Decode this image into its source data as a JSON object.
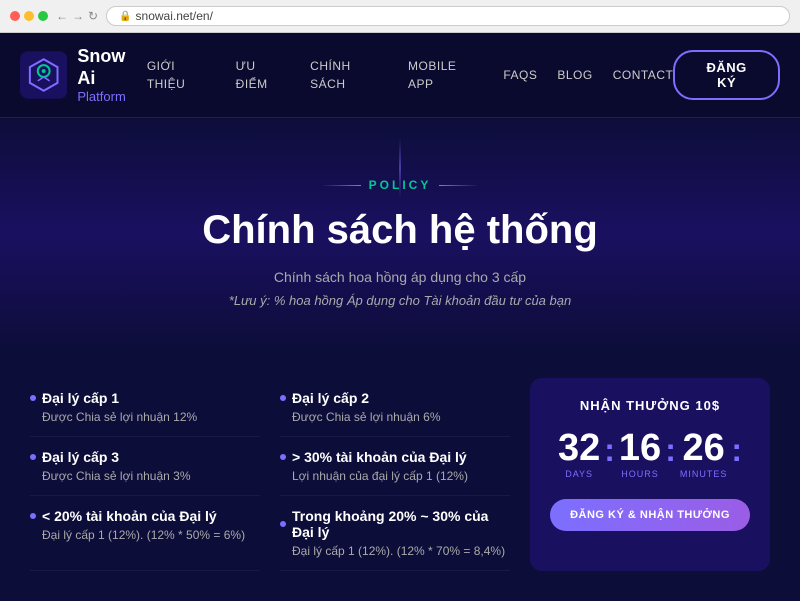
{
  "browser": {
    "url": "snowai.net/en/",
    "lock_text": "🔒"
  },
  "navbar": {
    "logo_name": "Snow Ai",
    "logo_sub": "Platform",
    "nav_items": [
      {
        "label": "GIỚI THIỆU",
        "href": "#"
      },
      {
        "label": "ƯU ĐIỂM",
        "href": "#"
      },
      {
        "label": "CHÍNH SÁCH",
        "href": "#"
      },
      {
        "label": "MOBILE APP",
        "href": "#"
      },
      {
        "label": "FAQS",
        "href": "#"
      },
      {
        "label": "BLOG",
        "href": "#"
      },
      {
        "label": "CONTACT",
        "href": "#"
      }
    ],
    "register_btn": "ĐĂNG KÝ"
  },
  "hero": {
    "policy_label": "POLICY",
    "title": "Chính sách hệ thống",
    "subtitle": "Chính sách hoa hồng áp dụng cho 3 cấp",
    "note": "*Lưu ý: % hoa hồng Áp dụng cho Tài khoản đầu tư của bạn"
  },
  "policy_items": [
    {
      "title": "Đại lý cấp 1",
      "desc": "Được Chia sẻ lợi nhuận 12%"
    },
    {
      "title": "Đại lý cấp 2",
      "desc": "Được Chia sẻ lợi nhuận 6%"
    },
    {
      "title": "Đại lý cấp 3",
      "desc": "Được Chia sẻ lợi nhuận 3%"
    },
    {
      "title": "> 30% tài khoản của Đại lý",
      "desc": "Lợi nhuận của đại lý cấp 1 (12%)"
    },
    {
      "title": "< 20% tài khoản của Đại lý",
      "desc": "Đại lý cấp 1 (12%). (12% * 50% = 6%)"
    },
    {
      "title": "Trong khoảng 20% ~ 30% của Đại lý",
      "desc": "Đại lý cấp 1 (12%). (12% * 70% = 8,4%)"
    }
  ],
  "countdown": {
    "title": "NHẬN THƯỞNG 10$",
    "days_value": "32",
    "days_label": "DAYS",
    "hours_value": "16",
    "hours_label": "HOURS",
    "minutes_value": "26",
    "minutes_label": "MINUTES",
    "btn_label": "ĐĂNG KÝ & NHẬN THƯỞNG"
  }
}
